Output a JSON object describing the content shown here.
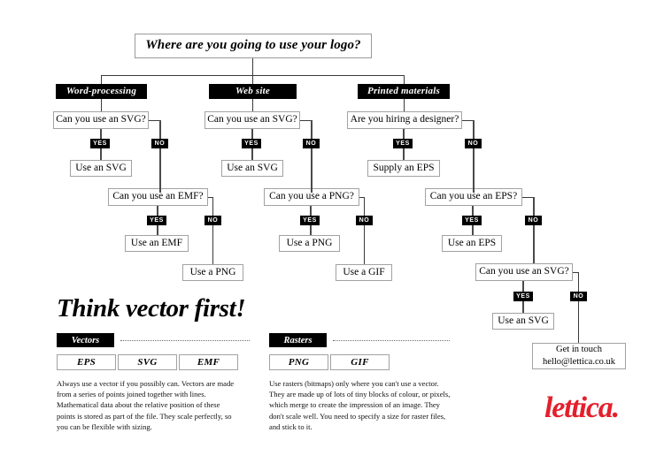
{
  "poster": {
    "root_question": "Where are you going to use your logo?",
    "headline": "Think vector first!",
    "logo": "lettica.",
    "logo_color": "#e3202c",
    "labels": {
      "yes": "YES",
      "no": "NO"
    }
  },
  "branches": {
    "word_processing": {
      "category": "Word-processing",
      "q1": "Can you use an SVG?",
      "q1_yes": "Use an SVG",
      "q2": "Can you use an EMF?",
      "q2_yes": "Use an EMF",
      "q2_no": "Use a PNG"
    },
    "web_site": {
      "category": "Web site",
      "q1": "Can you use an SVG?",
      "q1_yes": "Use an SVG",
      "q2": "Can you use a PNG?",
      "q2_yes": "Use a PNG",
      "q2_no": "Use a GIF"
    },
    "printed_materials": {
      "category": "Printed materials",
      "q1": "Are you hiring a designer?",
      "q1_yes": "Supply an EPS",
      "q2": "Can you use an EPS?",
      "q2_yes": "Use an EPS",
      "q3": "Can you use an SVG?",
      "q3_yes": "Use an SVG",
      "contact_line1": "Get in touch",
      "contact_line2": "hello@lettica.co.uk"
    }
  },
  "legend": {
    "vectors": {
      "tag": "Vectors",
      "formats": [
        "EPS",
        "SVG",
        "EMF"
      ],
      "text": "Always use a vector if you possibly can. Vectors are made from a series of points joined together with lines. Mathematical data about the relative position of these points is stored as part of the file. They scale perfectly, so you can be flexible with sizing."
    },
    "rasters": {
      "tag": "Rasters",
      "formats": [
        "PNG",
        "GIF"
      ],
      "text": "Use rasters (bitmaps) only where you can't use a vector. They are made up of lots of tiny blocks of colour, or pixels, which merge to create the impression of an image. They don't scale well. You need to specify a size for raster files, and stick to it."
    }
  }
}
